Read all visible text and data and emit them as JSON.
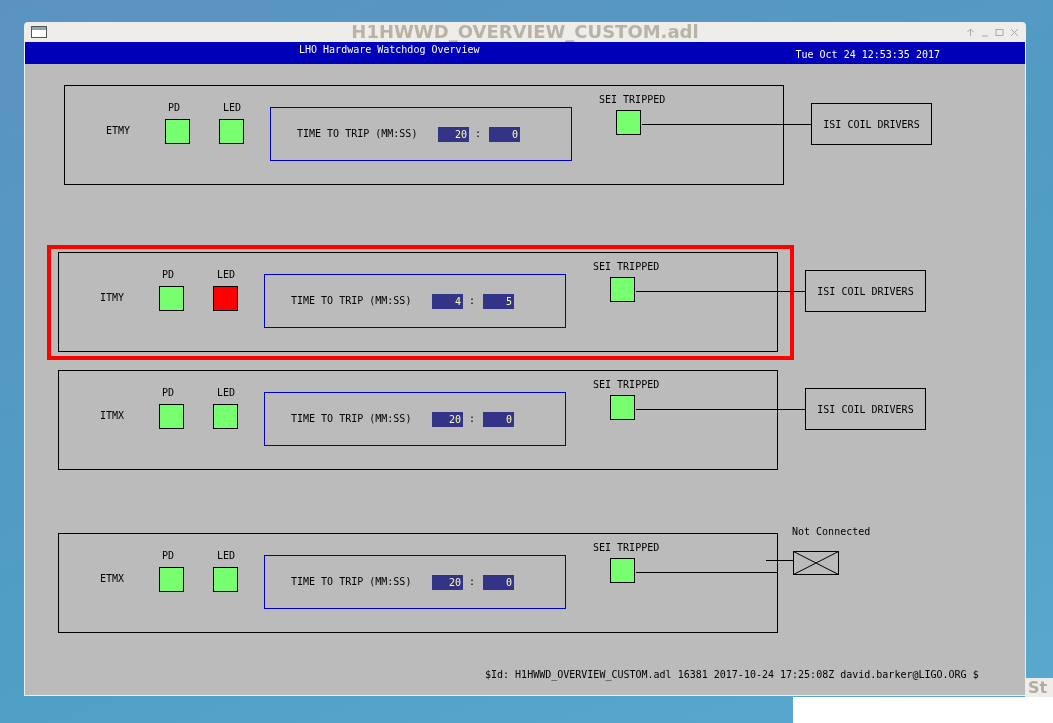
{
  "window": {
    "title": "H1HWWD_OVERVIEW_CUSTOM.adl"
  },
  "header": {
    "title": "LHO Hardware Watchdog Overview",
    "timestamp": "Tue Oct 24 12:53:35 2017"
  },
  "rows": [
    {
      "name": "ETMY",
      "highlighted": false,
      "pd": {
        "label": "PD",
        "color": "#77ff6f"
      },
      "led": {
        "label": "LED",
        "color": "#77ff6f"
      },
      "trip": {
        "label": "TIME TO TRIP (MM:SS)",
        "minutes": "20",
        "separator": ":",
        "seconds": "0"
      },
      "sei": {
        "label": "SEI TRIPPED",
        "color": "#77ff6f"
      },
      "output": {
        "kind": "driver",
        "label": "ISI COIL DRIVERS"
      }
    },
    {
      "name": "ITMY",
      "highlighted": true,
      "pd": {
        "label": "PD",
        "color": "#77ff6f"
      },
      "led": {
        "label": "LED",
        "color": "#ff0000"
      },
      "trip": {
        "label": "TIME TO TRIP (MM:SS)",
        "minutes": "4",
        "separator": ":",
        "seconds": "5"
      },
      "sei": {
        "label": "SEI TRIPPED",
        "color": "#77ff6f"
      },
      "output": {
        "kind": "driver",
        "label": "ISI COIL DRIVERS"
      }
    },
    {
      "name": "ITMX",
      "highlighted": false,
      "pd": {
        "label": "PD",
        "color": "#77ff6f"
      },
      "led": {
        "label": "LED",
        "color": "#77ff6f"
      },
      "trip": {
        "label": "TIME TO TRIP (MM:SS)",
        "minutes": "20",
        "separator": ":",
        "seconds": "0"
      },
      "sei": {
        "label": "SEI TRIPPED",
        "color": "#77ff6f"
      },
      "output": {
        "kind": "driver",
        "label": "ISI COIL DRIVERS"
      }
    },
    {
      "name": "ETMX",
      "highlighted": false,
      "pd": {
        "label": "PD",
        "color": "#77ff6f"
      },
      "led": {
        "label": "LED",
        "color": "#77ff6f"
      },
      "trip": {
        "label": "TIME TO TRIP (MM:SS)",
        "minutes": "20",
        "separator": ":",
        "seconds": "0"
      },
      "sei": {
        "label": "SEI TRIPPED",
        "color": "#77ff6f"
      },
      "output": {
        "kind": "not_connected",
        "label": "Not Connected"
      }
    }
  ],
  "footer": {
    "id_text": "$Id: H1HWWD_OVERVIEW_CUSTOM.adl 16381 2017-10-24 17:25:08Z david.barker@LIGO.ORG $"
  },
  "background_window": {
    "title": "St"
  }
}
